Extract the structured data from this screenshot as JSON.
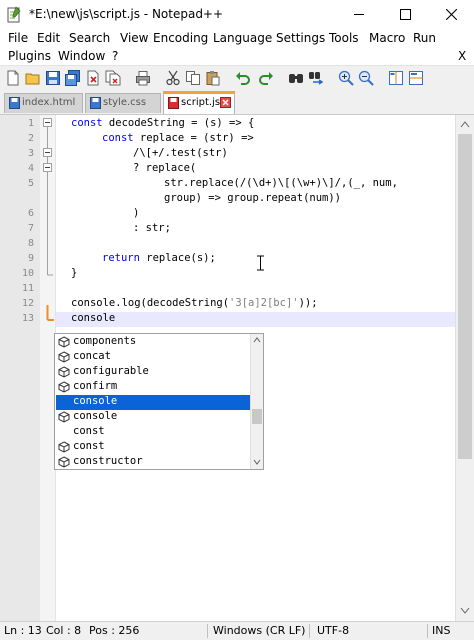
{
  "window": {
    "title": "*E:\\new\\js\\script.js - Notepad++"
  },
  "menu": [
    "File",
    "Edit",
    "Search",
    "View",
    "Encoding",
    "Language",
    "Settings",
    "Tools",
    "Macro",
    "Run",
    "Plugins",
    "Window",
    "?"
  ],
  "menu_close": "X",
  "toolbar_icons": [
    "new-file-icon",
    "open-file-icon",
    "save-icon",
    "save-all-icon",
    "close-icon",
    "close-all-icon",
    "print-icon",
    "cut-icon",
    "copy-icon",
    "paste-icon",
    "undo-icon",
    "redo-icon",
    "find-icon",
    "replace-icon",
    "zoom-in-icon",
    "zoom-out-icon",
    "sync-vertical-icon",
    "sync-horizontal-icon"
  ],
  "tabs": [
    {
      "label": "index.html",
      "active": false
    },
    {
      "label": "style.css",
      "active": false
    },
    {
      "label": "script.js",
      "active": true
    }
  ],
  "line_numbers": [
    "1",
    "2",
    "3",
    "4",
    "5",
    "6",
    "7",
    "8",
    "9",
    "10",
    "11",
    "12",
    "13"
  ],
  "code": {
    "l1_kw": "const",
    "l1_rest": " decodeString = (s) => {",
    "l2_kw": "const",
    "l2_rest": " replace = (str) =>",
    "l3": "/\\[+/.test(str)",
    "l4": "? replace(",
    "l5": "str.replace(/(\\d+)\\[(\\w+)\\]/,(_, num,",
    "l5b": "group) => group.repeat(num))",
    "l6": ")",
    "l7": ": str;",
    "l9_kw": "return",
    "l9_rest": " replace(s);",
    "l10": "}",
    "l12_a": "console.log(decodeString(",
    "l12_str": "'3[a]2[bc]'",
    "l12_b": "));",
    "l13": "console"
  },
  "autocomplete": {
    "items": [
      "components",
      "concat",
      "configurable",
      "confirm",
      "console",
      "console",
      "const",
      "const",
      "constructor"
    ],
    "selected_index": 4,
    "icon_items": [
      0,
      1,
      2,
      3,
      5,
      7,
      8
    ]
  },
  "status": {
    "ln": "Ln : 13",
    "col": "Col : 8",
    "pos": "Pos : 256",
    "eol": "Windows (CR LF)",
    "encoding": "UTF-8",
    "mode": "INS"
  },
  "colors": {
    "keyword": "#0000ff",
    "string": "#808080",
    "selection": "#0a64d8",
    "active_tab_accent": "#f7a03a"
  }
}
